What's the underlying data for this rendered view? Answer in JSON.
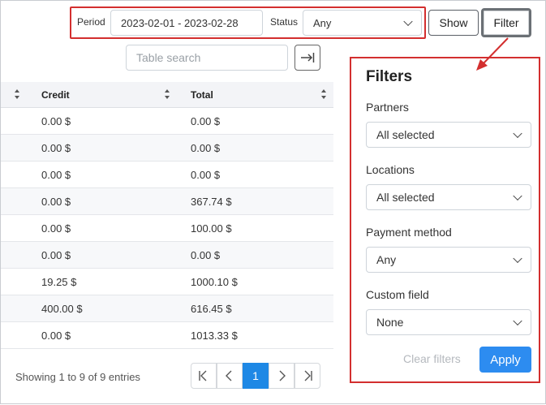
{
  "toolbar": {
    "period_label": "Period",
    "period_value": "2023-02-01 - 2023-02-28",
    "status_label": "Status",
    "status_value": "Any",
    "show_label": "Show",
    "filter_label": "Filter"
  },
  "search": {
    "placeholder": "Table search"
  },
  "table": {
    "columns": [
      "Credit",
      "Total"
    ],
    "rows": [
      {
        "credit": "0.00 $",
        "total": "0.00 $"
      },
      {
        "credit": "0.00 $",
        "total": "0.00 $"
      },
      {
        "credit": "0.00 $",
        "total": "0.00 $"
      },
      {
        "credit": "0.00 $",
        "total": "367.74 $"
      },
      {
        "credit": "0.00 $",
        "total": "100.00 $"
      },
      {
        "credit": "0.00 $",
        "total": "0.00 $"
      },
      {
        "credit": "19.25 $",
        "total": "1000.10 $"
      },
      {
        "credit": "400.00 $",
        "total": "616.45 $"
      },
      {
        "credit": "0.00 $",
        "total": "1013.33 $"
      }
    ]
  },
  "pagination": {
    "summary": "Showing 1 to 9 of 9 entries",
    "current_page": "1"
  },
  "filters": {
    "title": "Filters",
    "partners_label": "Partners",
    "partners_value": "All selected",
    "locations_label": "Locations",
    "locations_value": "All selected",
    "payment_method_label": "Payment method",
    "payment_method_value": "Any",
    "custom_field_label": "Custom field",
    "custom_field_value": "None",
    "clear_label": "Clear filters",
    "apply_label": "Apply"
  },
  "colors": {
    "highlight": "#d32f2f",
    "accent": "#1e88e5",
    "apply": "#2d8cf0"
  }
}
